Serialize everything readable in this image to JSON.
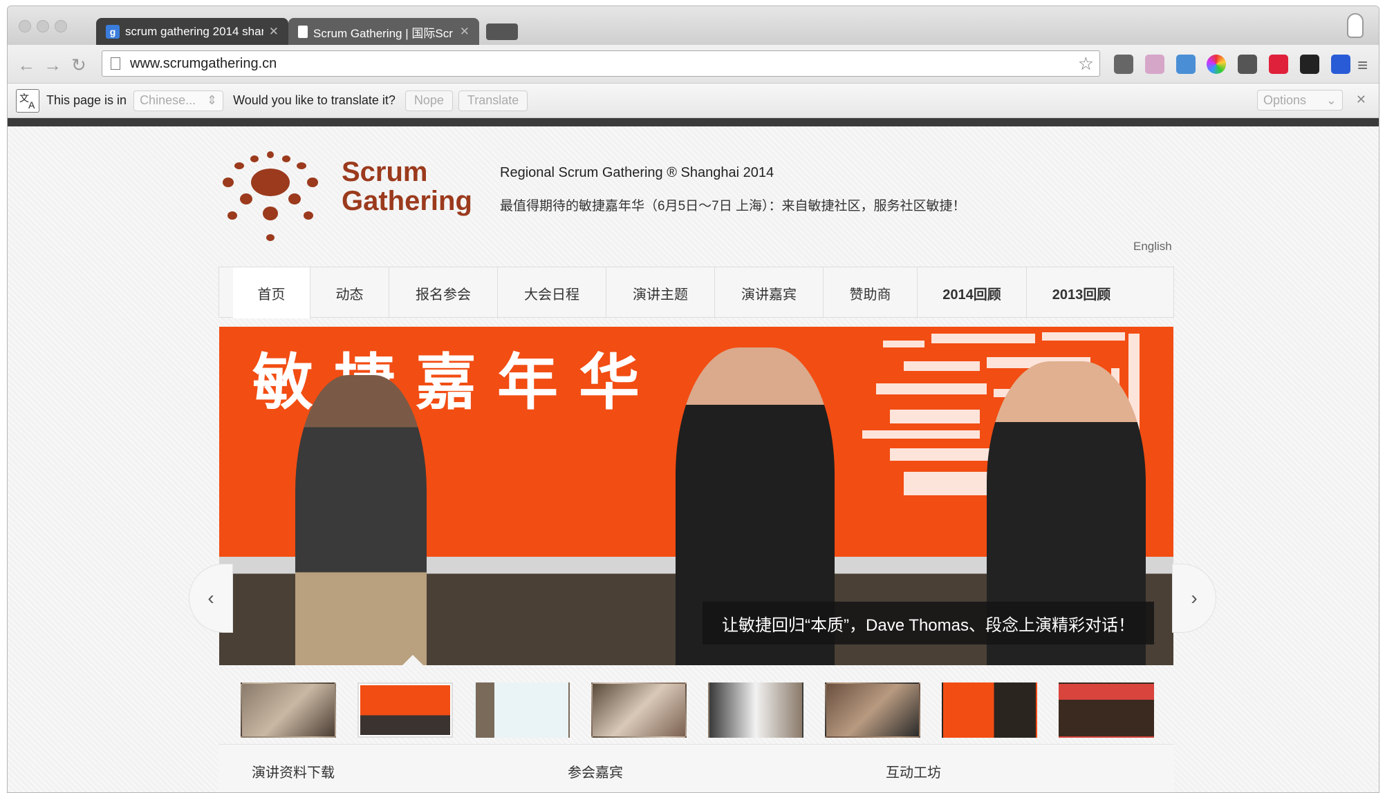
{
  "browser": {
    "tabs": [
      {
        "favicon": "google-g-icon",
        "favicon_text": "g",
        "title": "scrum gathering 2014 shar"
      },
      {
        "favicon": "page-icon",
        "title": "Scrum Gathering | 国际Scr"
      }
    ],
    "url": "www.scrumgathering.cn",
    "translate_bar": {
      "prefix": "This page is in",
      "language": "Chinese...",
      "question": "Would you like to translate it?",
      "nope": "Nope",
      "translate": "Translate",
      "options": "Options"
    }
  },
  "site": {
    "logo_line1": "Scrum",
    "logo_line2": "Gathering",
    "tagline_en": "Regional Scrum Gathering ® Shanghai 2014",
    "tagline_cn": "最值得期待的敏捷嘉年华（6月5日～7日 上海）：来自敏捷社区，服务社区敏捷！",
    "language_link": "English",
    "nav": [
      {
        "label": "首页",
        "active": true
      },
      {
        "label": "动态"
      },
      {
        "label": "报名参会"
      },
      {
        "label": "大会日程"
      },
      {
        "label": "演讲主题"
      },
      {
        "label": "演讲嘉宾"
      },
      {
        "label": "赞助商"
      },
      {
        "label": "2014回顾"
      },
      {
        "label": "2013回顾"
      }
    ],
    "slider": {
      "banner_text": "敏捷嘉年华",
      "caption": "让敏捷回归“本质”，Dave Thomas、段念上演精彩对话！",
      "prev": "‹",
      "next": "›",
      "active_thumb": 1,
      "thumb_count": 8
    },
    "sections": [
      "演讲资料下载",
      "参会嘉宾",
      "互动工坊"
    ]
  },
  "colors": {
    "brand": "#9b3a1d",
    "banner_red": "#f24d13"
  }
}
